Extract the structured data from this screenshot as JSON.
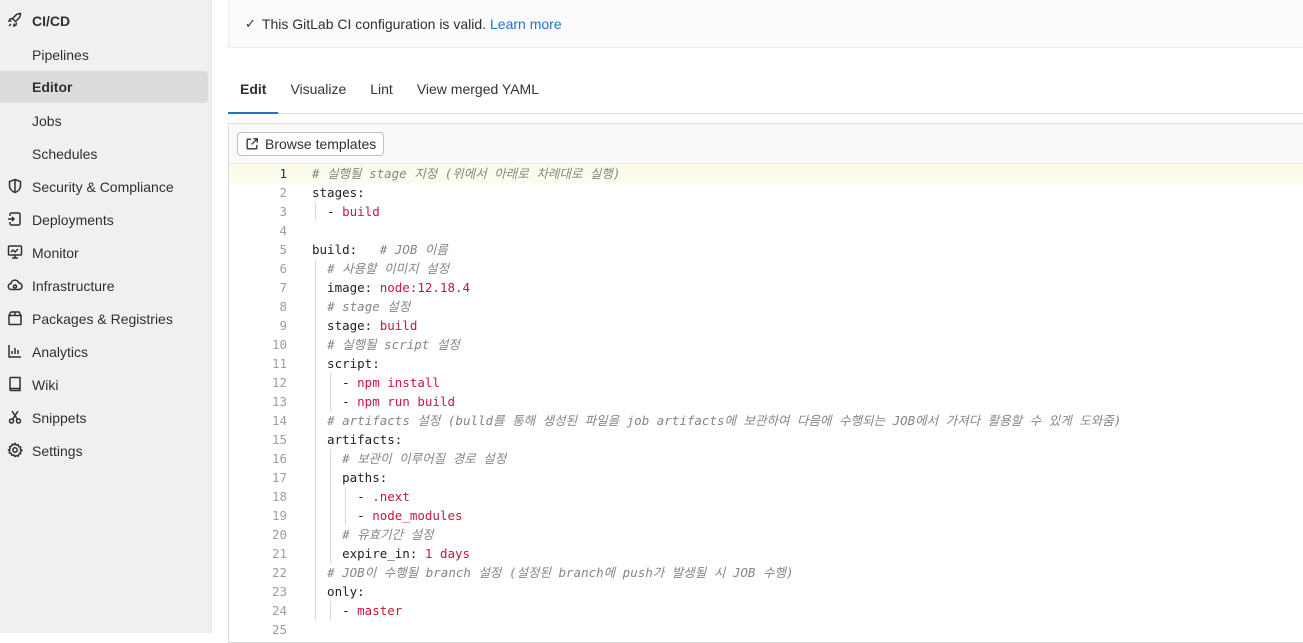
{
  "sidebar": {
    "section": {
      "label": "CI/CD",
      "icon": "rocket-icon"
    },
    "sub_items": [
      {
        "label": "Pipelines",
        "active": false
      },
      {
        "label": "Editor",
        "active": true
      },
      {
        "label": "Jobs",
        "active": false
      },
      {
        "label": "Schedules",
        "active": false
      }
    ],
    "items": [
      {
        "label": "Security & Compliance",
        "icon": "shield-icon"
      },
      {
        "label": "Deployments",
        "icon": "deployments-icon"
      },
      {
        "label": "Monitor",
        "icon": "monitor-icon"
      },
      {
        "label": "Infrastructure",
        "icon": "cloud-icon"
      },
      {
        "label": "Packages & Registries",
        "icon": "package-icon"
      },
      {
        "label": "Analytics",
        "icon": "chart-icon"
      },
      {
        "label": "Wiki",
        "icon": "book-icon"
      },
      {
        "label": "Snippets",
        "icon": "scissors-icon"
      },
      {
        "label": "Settings",
        "icon": "gear-icon"
      }
    ]
  },
  "alert": {
    "check": "✓",
    "message": "This GitLab CI configuration is valid.",
    "link": "Learn more"
  },
  "tabs": [
    {
      "label": "Edit",
      "active": true
    },
    {
      "label": "Visualize",
      "active": false
    },
    {
      "label": "Lint",
      "active": false
    },
    {
      "label": "View merged YAML",
      "active": false
    }
  ],
  "toolbar": {
    "browse_label": "Browse templates",
    "browse_icon": "external-link-icon"
  },
  "code": {
    "current_line": 1,
    "lines": [
      [
        {
          "t": "# 실행될 stage 지정 (위에서 아래로 차례대로 실행)",
          "c": "cm"
        }
      ],
      [
        {
          "t": "stages:",
          "c": "key"
        }
      ],
      [
        {
          "t": "  - ",
          "c": "key"
        },
        {
          "t": "build",
          "c": "val"
        }
      ],
      [],
      [
        {
          "t": "build:",
          "c": "key"
        },
        {
          "t": "   # JOB 이름",
          "c": "cm"
        }
      ],
      [
        {
          "t": "  ",
          "c": "key"
        },
        {
          "t": "# 사용할 이미지 설정",
          "c": "cm"
        }
      ],
      [
        {
          "t": "  image: ",
          "c": "key"
        },
        {
          "t": "node:12.18.4",
          "c": "val"
        }
      ],
      [
        {
          "t": "  ",
          "c": "key"
        },
        {
          "t": "# stage 설정",
          "c": "cm"
        }
      ],
      [
        {
          "t": "  stage: ",
          "c": "key"
        },
        {
          "t": "build",
          "c": "val"
        }
      ],
      [
        {
          "t": "  ",
          "c": "key"
        },
        {
          "t": "# 실행될 script 설정",
          "c": "cm"
        }
      ],
      [
        {
          "t": "  script:",
          "c": "key"
        }
      ],
      [
        {
          "t": "    - ",
          "c": "key"
        },
        {
          "t": "npm install",
          "c": "val"
        }
      ],
      [
        {
          "t": "    - ",
          "c": "key"
        },
        {
          "t": "npm run build",
          "c": "val"
        }
      ],
      [
        {
          "t": "  ",
          "c": "key"
        },
        {
          "t": "# artifacts 설정 (bulld를 통해 생성된 파일을 job artifacts에 보관하여 다음에 수행되는 JOB에서 가져다 활용할 수 있게 도와줌)",
          "c": "cm"
        }
      ],
      [
        {
          "t": "  artifacts:",
          "c": "key"
        }
      ],
      [
        {
          "t": "    ",
          "c": "key"
        },
        {
          "t": "# 보관이 이루어질 경로 설정",
          "c": "cm"
        }
      ],
      [
        {
          "t": "    paths:",
          "c": "key"
        }
      ],
      [
        {
          "t": "      - ",
          "c": "key"
        },
        {
          "t": ".next",
          "c": "val"
        }
      ],
      [
        {
          "t": "      - ",
          "c": "key"
        },
        {
          "t": "node_modules",
          "c": "val"
        }
      ],
      [
        {
          "t": "    ",
          "c": "key"
        },
        {
          "t": "# 유효기간 설정",
          "c": "cm"
        }
      ],
      [
        {
          "t": "    expire_in: ",
          "c": "key"
        },
        {
          "t": "1 days",
          "c": "val"
        }
      ],
      [
        {
          "t": "  ",
          "c": "key"
        },
        {
          "t": "# JOB이 수행될 branch 설정 (설정된 branch에 push가 발생될 시 JOB 수행)",
          "c": "cm"
        }
      ],
      [
        {
          "t": "  only:",
          "c": "key"
        }
      ],
      [
        {
          "t": "    - ",
          "c": "key"
        },
        {
          "t": "master",
          "c": "val"
        }
      ],
      []
    ],
    "line_numbers": [
      "1",
      "2",
      "3",
      "4",
      "5",
      "6",
      "7",
      "8",
      "9",
      "10",
      "11",
      "12",
      "13",
      "14",
      "15",
      "16",
      "17",
      "18",
      "19",
      "20",
      "21",
      "22",
      "23",
      "24",
      "25"
    ]
  }
}
